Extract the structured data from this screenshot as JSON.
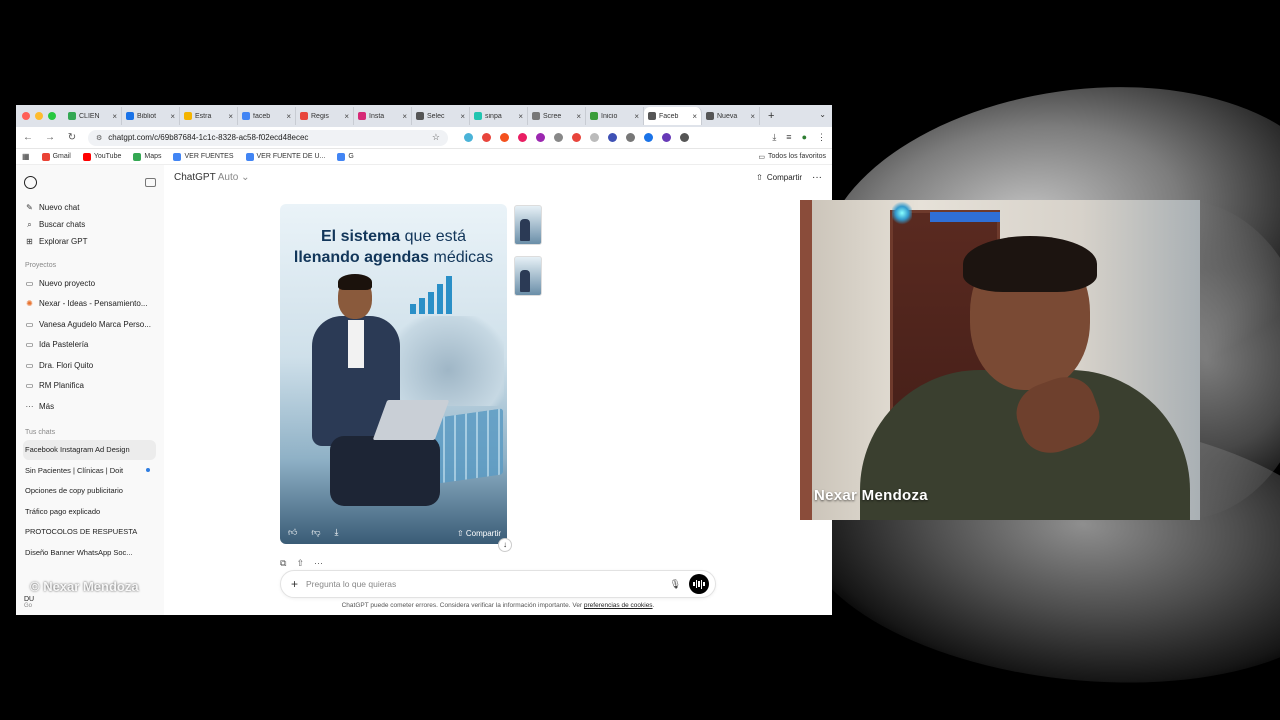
{
  "tabs": [
    {
      "label": "CLIEN",
      "color": "#34a853"
    },
    {
      "label": "Bibliot",
      "color": "#1a73e8"
    },
    {
      "label": "Estra",
      "color": "#f4b400"
    },
    {
      "label": "faceb",
      "color": "#4285f4"
    },
    {
      "label": "Regis",
      "color": "#e8453c"
    },
    {
      "label": "Insta",
      "color": "#d62976"
    },
    {
      "label": "Selec",
      "color": "#555555"
    },
    {
      "label": "sinpa",
      "color": "#21c5b0"
    },
    {
      "label": "Scree",
      "color": "#777777"
    },
    {
      "label": "Inicio",
      "color": "#3a9d3a"
    },
    {
      "label": "Faceb",
      "color": "#555555"
    },
    {
      "label": "Nueva",
      "color": "#555555"
    }
  ],
  "address": {
    "url": "chatgpt.com/c/69b87684-1c1c-8328-ac58-f02ecd48ecec"
  },
  "bookmarks": {
    "items": [
      {
        "label": "Gmail",
        "color": "#ea4335"
      },
      {
        "label": "YouTube",
        "color": "#ff0000"
      },
      {
        "label": "Maps",
        "color": "#34a853"
      },
      {
        "label": "VER FUENTES",
        "color": "#4285f4"
      },
      {
        "label": "VER FUENTE DE U...",
        "color": "#4285f4"
      },
      {
        "label": "G",
        "color": "#4285f4"
      }
    ],
    "all_label": "Todos los favoritos"
  },
  "sidebar": {
    "top": [
      {
        "label": "Nuevo chat",
        "icon": "pencil-icon"
      },
      {
        "label": "Buscar chats",
        "icon": "search-icon"
      },
      {
        "label": "Explorar GPT",
        "icon": "grid-icon"
      }
    ],
    "projects_title": "Proyectos",
    "projects": [
      "Nuevo proyecto",
      "Nexar - Ideas - Pensamiento...",
      "Vanesa Agudelo Marca Perso...",
      "Ida Pastelería",
      "Dra. Flori Quito",
      "RM Planifica",
      "Más"
    ],
    "chats_title": "Tus chats",
    "chats": [
      "Facebook Instagram Ad Design",
      "Sin Pacientes | Clínicas | Doit",
      "Opciones de copy publicitario",
      "Tráfico pago explicado",
      "PROTOCOLOS DE RESPUESTA",
      "Diseño Banner WhatsApp Soc..."
    ],
    "user": {
      "name": "DU",
      "plan": "Go"
    }
  },
  "header": {
    "model": "ChatGPT",
    "mode": "Auto",
    "share": "Compartir"
  },
  "image": {
    "title_bold_1": "El sistema",
    "title_light": " que está",
    "title_bold_2": "llenando agendas",
    "title_light_2": " médicas",
    "share_label": "Compartir"
  },
  "composer": {
    "placeholder": "Pregunta lo que quieras"
  },
  "footnote": {
    "text": "ChatGPT puede cometer errores. Considera verificar la información importante. Ver ",
    "link": "preferencias de cookies",
    "end": "."
  },
  "webcam": {
    "name": "Nexar Mendoza"
  },
  "watermark": "© Nexar Mendoza"
}
